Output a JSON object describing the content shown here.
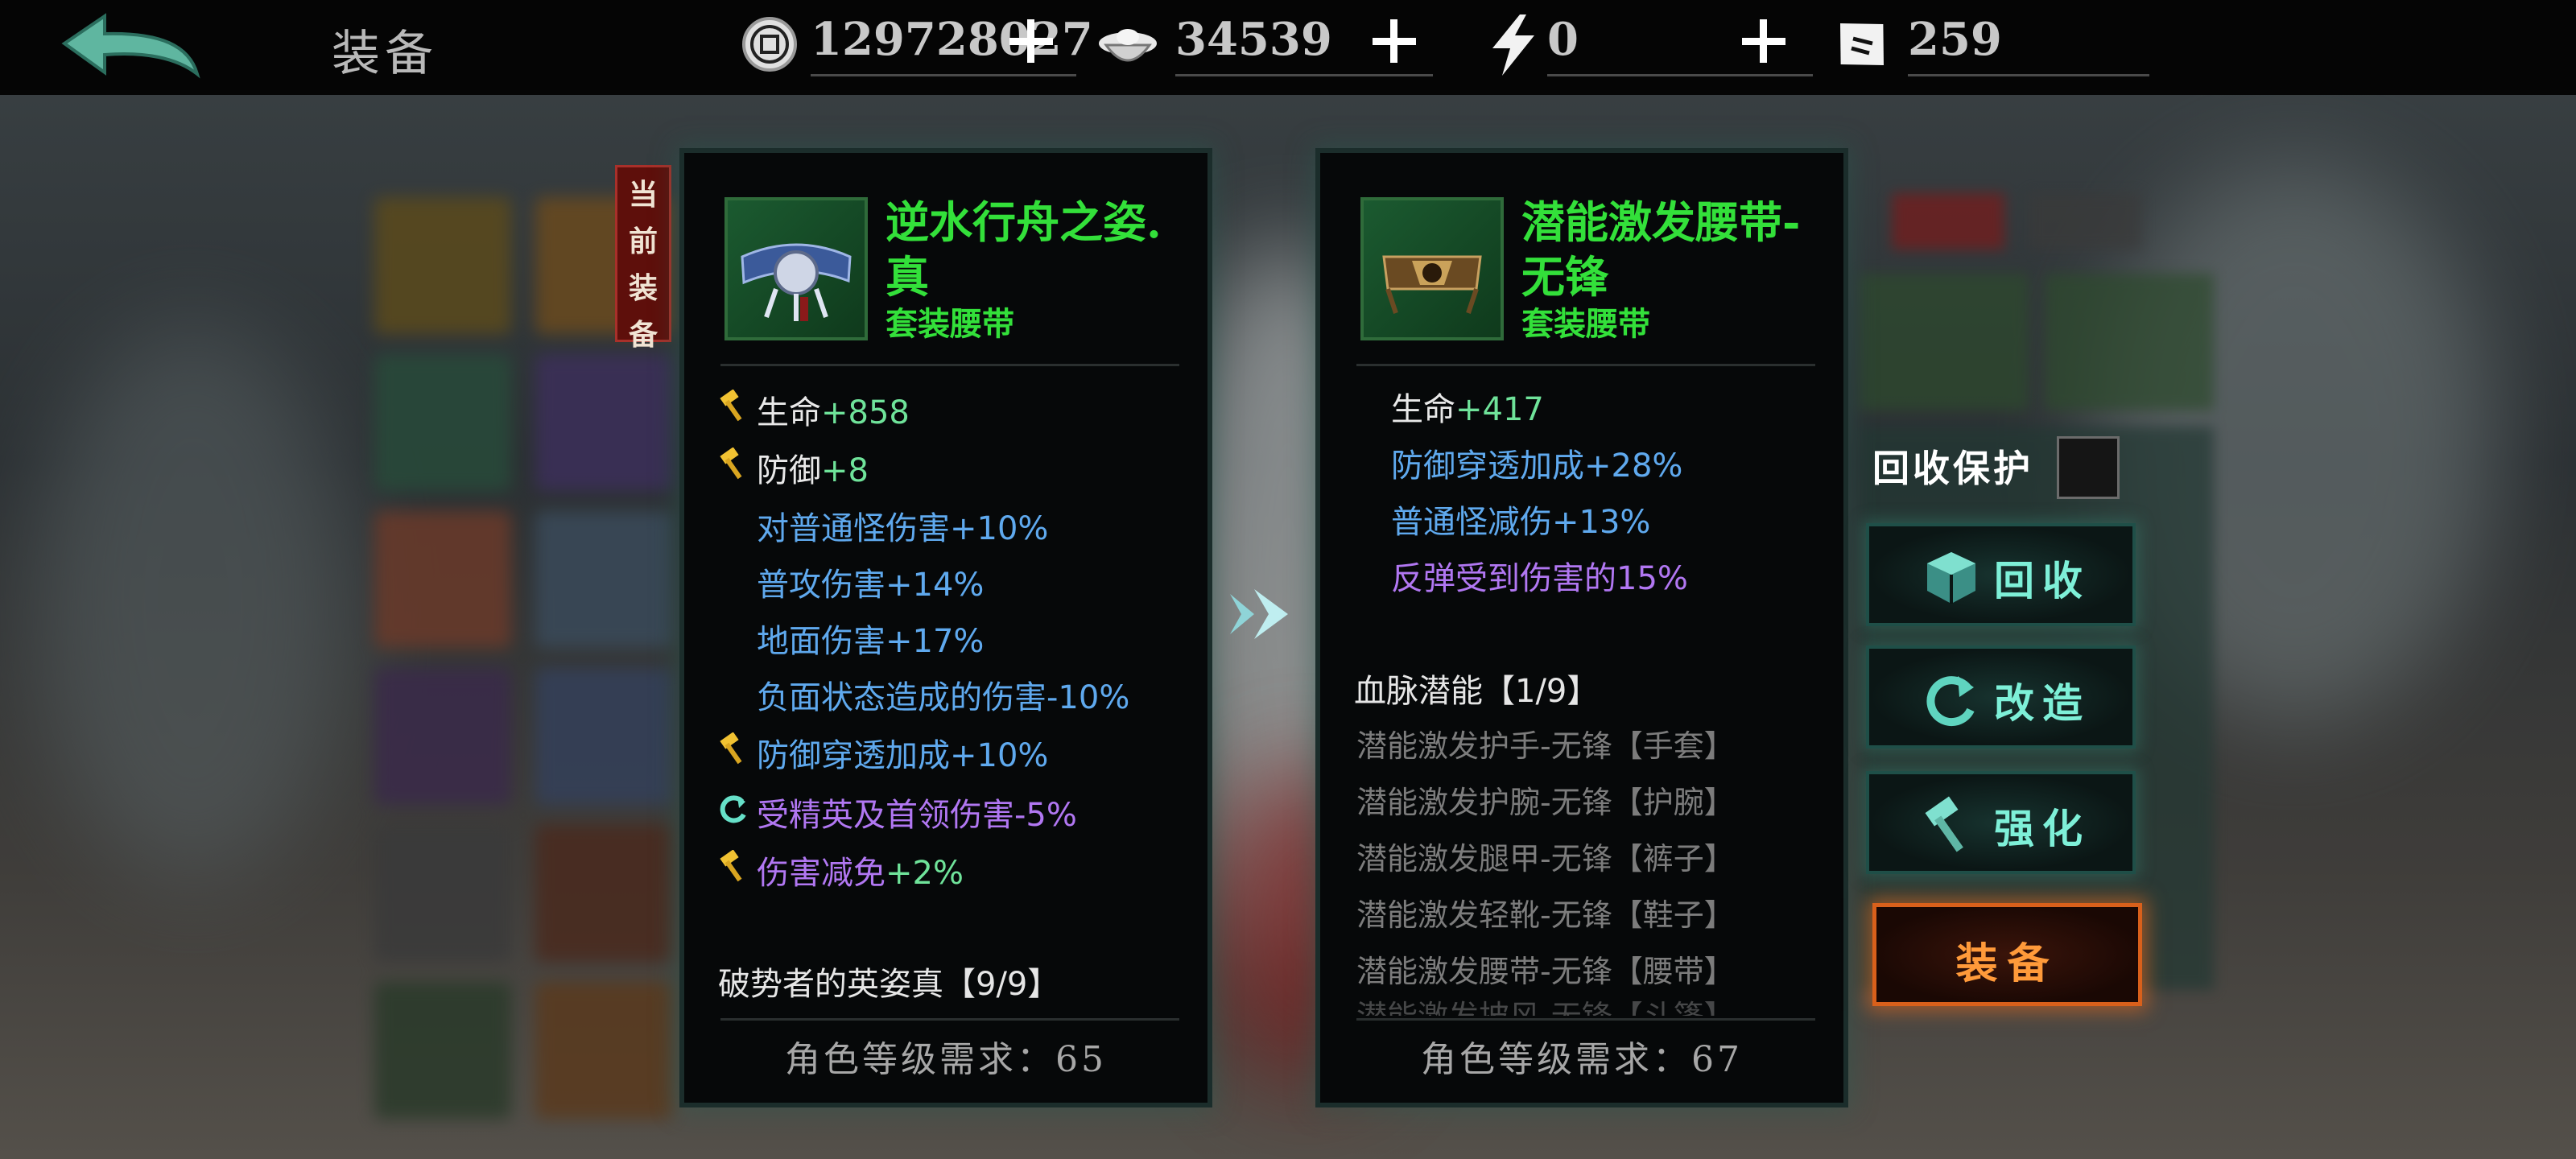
{
  "header": {
    "title": "装备",
    "resources": [
      {
        "icon": "coin-icon",
        "value": "129728027"
      },
      {
        "icon": "ingot-icon",
        "value": "34539"
      },
      {
        "icon": "lightning-icon",
        "value": "0"
      },
      {
        "icon": "ticket-icon",
        "value": "259"
      }
    ]
  },
  "current_tag": [
    "当",
    "前",
    "装",
    "备"
  ],
  "current_item": {
    "name": "逆水行舟之姿.真",
    "type": "套装腰带",
    "stats": [
      {
        "label": "生命",
        "value": "+858",
        "marker": "hammer-icon"
      },
      {
        "label": "防御",
        "value": "+8",
        "marker": "hammer-icon"
      },
      {
        "label": "对普通怪伤害",
        "value": "+10%"
      },
      {
        "label": "普攻伤害",
        "value": "+14%"
      },
      {
        "label": "地面伤害",
        "value": "+17%"
      },
      {
        "label": "负面状态造成的伤害",
        "value": "-10%"
      },
      {
        "label": "防御穿透加成",
        "value": "+10%",
        "marker": "hammer-icon"
      },
      {
        "label": "受精英及首领伤害",
        "value": "-5%",
        "marker": "refresh-icon"
      },
      {
        "label": "伤害减免",
        "value": "+2%",
        "marker": "hammer-icon"
      }
    ],
    "set_title": "破势者的英姿真【9/9】",
    "requirement": "角色等级需求：65"
  },
  "new_item": {
    "name": "潜能激发腰带-无锋",
    "type": "套装腰带",
    "stats": [
      {
        "label": "生命",
        "value": "+417"
      },
      {
        "label": "防御穿透加成",
        "value": "+28%"
      },
      {
        "label": "普通怪减伤",
        "value": "+13%"
      },
      {
        "label": "反弹受到伤害的",
        "value": "15%"
      }
    ],
    "set_title": "血脉潜能【1/9】",
    "set_items": [
      "潜能激发护手-无锋【手套】",
      "潜能激发护腕-无锋【护腕】",
      "潜能激发腿甲-无锋【裤子】",
      "潜能激发轻靴-无锋【鞋子】",
      "潜能激发腰带-无锋【腰带】",
      "潜能激发披风-无锋【斗篷】"
    ],
    "requirement": "角色等级需求：67"
  },
  "actions": {
    "protect_label": "回收保护",
    "recycle": "回收",
    "reforge": "改造",
    "enhance": "强化",
    "equip": "装备"
  },
  "colors": {
    "item_name": "#33e03a",
    "stat_value": "#6fe39a",
    "stat_blue": "#5fa9ee",
    "stat_purple": "#b177f2",
    "action_text": "#7ef0d8",
    "equip_text": "#ff9a3a"
  }
}
